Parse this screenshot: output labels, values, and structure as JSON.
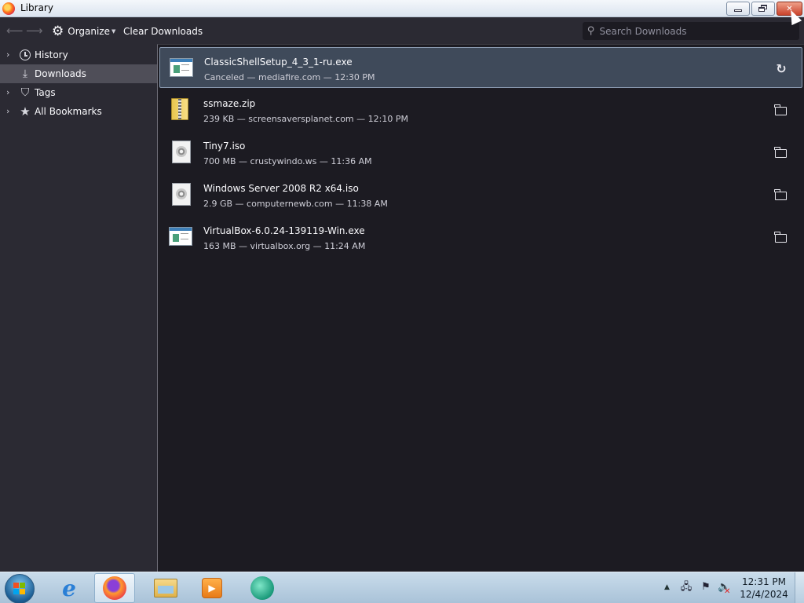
{
  "window": {
    "title": "Library",
    "controls": {
      "minimize": "minimize",
      "maximize": "restore",
      "close": "✕"
    }
  },
  "toolbar": {
    "organize_label": "Organize",
    "clear_downloads_label": "Clear Downloads",
    "search_placeholder": "Search Downloads",
    "search_value": ""
  },
  "sidebar": {
    "items": [
      {
        "label": "History",
        "icon": "clock-icon",
        "expandable": true,
        "selected": false
      },
      {
        "label": "Downloads",
        "icon": "download-icon",
        "expandable": false,
        "selected": true
      },
      {
        "label": "Tags",
        "icon": "tag-icon",
        "expandable": true,
        "selected": false
      },
      {
        "label": "All Bookmarks",
        "icon": "star-icon",
        "expandable": true,
        "selected": false
      }
    ]
  },
  "downloads": [
    {
      "name": "ClassicShellSetup_4_3_1-ru.exe",
      "status": "Canceled — mediafire.com — 12:30 PM",
      "file_icon": "exe-file-icon",
      "action_icon": "retry-icon",
      "selected": true
    },
    {
      "name": "ssmaze.zip",
      "status": "239 KB — screensaversplanet.com — 12:10 PM",
      "file_icon": "zip-file-icon",
      "action_icon": "folder-icon",
      "selected": false
    },
    {
      "name": "Tiny7.iso",
      "status": "700 MB — crustywindo.ws — 11:36 AM",
      "file_icon": "iso-file-icon",
      "action_icon": "folder-icon",
      "selected": false
    },
    {
      "name": "Windows Server 2008 R2 x64.iso",
      "status": "2.9 GB — computernewb.com — 11:38 AM",
      "file_icon": "iso-file-icon",
      "action_icon": "folder-icon",
      "selected": false
    },
    {
      "name": "VirtualBox-6.0.24-139119-Win.exe",
      "status": "163 MB — virtualbox.org — 11:24 AM",
      "file_icon": "exe-file-icon",
      "action_icon": "folder-icon",
      "selected": false
    }
  ],
  "taskbar": {
    "apps": [
      "internet-explorer-icon",
      "firefox-icon",
      "file-explorer-icon",
      "media-player-icon",
      "app-icon"
    ],
    "clock_time": "12:31 PM",
    "clock_date": "12/4/2024"
  },
  "colors": {
    "sidebar_bg": "#2b2a33",
    "main_bg": "#1c1b22",
    "selected_row_bg": "#3f4a5a",
    "close_button": "#c9432c"
  }
}
